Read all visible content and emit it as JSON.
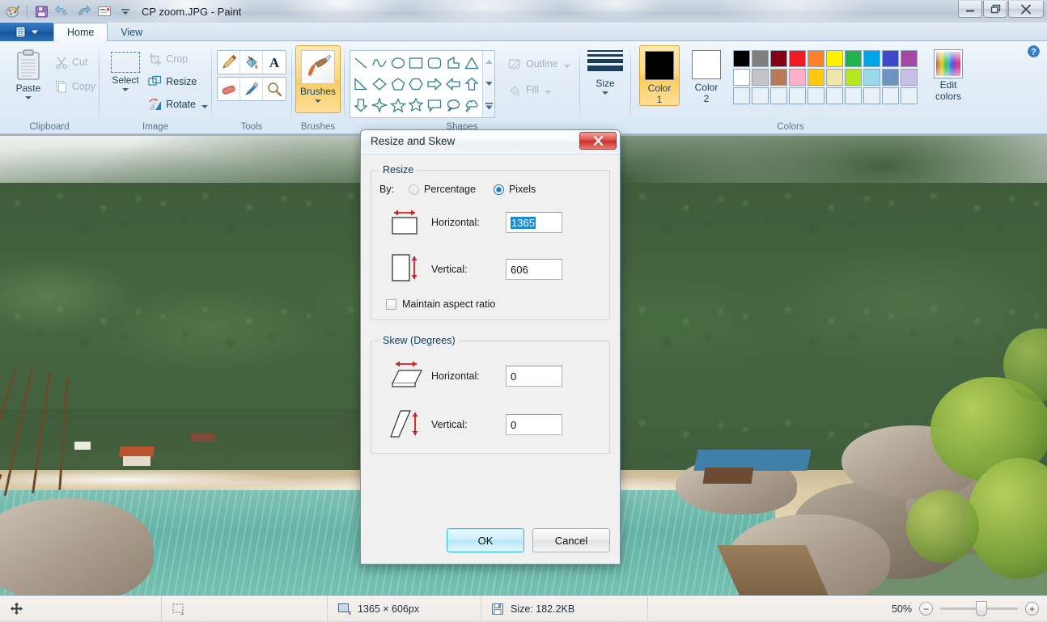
{
  "window": {
    "title": "CP zoom.JPG - Paint",
    "quick_access": [
      {
        "name": "paint-app-icon",
        "label": "Paint"
      },
      {
        "name": "save-icon",
        "label": "Save"
      },
      {
        "name": "undo-icon",
        "label": "Undo"
      },
      {
        "name": "redo-icon",
        "label": "Redo"
      },
      {
        "name": "print-preview-icon",
        "label": "Print preview"
      },
      {
        "name": "customize-qat-icon",
        "label": "Customize Quick Access Toolbar"
      }
    ],
    "controls": [
      {
        "name": "minimize-button",
        "label": "Minimize"
      },
      {
        "name": "restore-button",
        "label": "Restore Down"
      },
      {
        "name": "close-button",
        "label": "Close"
      }
    ]
  },
  "ribbon": {
    "app_menu_label": "File",
    "tabs": [
      {
        "label": "Home",
        "active": true
      },
      {
        "label": "View",
        "active": false
      }
    ],
    "help_label": "Help",
    "groups": [
      {
        "title": "Clipboard",
        "items": [
          {
            "label": "Paste",
            "type": "big",
            "enabled": true
          },
          {
            "label": "Cut",
            "type": "small",
            "enabled": false
          },
          {
            "label": "Copy",
            "type": "small",
            "enabled": false
          }
        ]
      },
      {
        "title": "Image",
        "items": [
          {
            "label": "Select",
            "type": "big",
            "enabled": true
          },
          {
            "label": "Crop",
            "type": "small",
            "enabled": false
          },
          {
            "label": "Resize",
            "type": "small",
            "enabled": true
          },
          {
            "label": "Rotate",
            "type": "small",
            "enabled": true
          }
        ]
      },
      {
        "title": "Tools",
        "tools": [
          "pencil-icon",
          "fill-with-color-icon",
          "text-icon",
          "eraser-icon",
          "color-picker-icon",
          "magnifier-icon"
        ]
      },
      {
        "title": "Brushes",
        "label": "Brushes",
        "selected": true
      },
      {
        "title": "Shapes",
        "shapes": [
          "line",
          "curve",
          "oval",
          "rectangle",
          "rounded-rectangle",
          "polygon",
          "triangle",
          "right-triangle",
          "diamond",
          "pentagon",
          "hexagon",
          "right-arrow",
          "left-arrow",
          "up-arrow",
          "down-arrow",
          "four-point-star",
          "five-point-star",
          "six-point-star",
          "rounded-callout",
          "oval-callout",
          "cloud-callout"
        ],
        "outline_label": "Outline",
        "fill_label": "Fill"
      },
      {
        "title": "Size",
        "label": "Size"
      },
      {
        "title": "Colors",
        "color1_label": "Color\n1",
        "color1_line1": "Color",
        "color1_line2": "1",
        "color2_line1": "Color",
        "color2_line2": "2",
        "color1_value": "#000000",
        "color2_value": "#ffffff",
        "edit_colors_line1": "Edit",
        "edit_colors_line2": "colors",
        "palette_row1": [
          "#000000",
          "#7f7f7f",
          "#880015",
          "#ed1c24",
          "#ff7f27",
          "#fff200",
          "#22b14c",
          "#00a2e8",
          "#3f48cc",
          "#a349a4"
        ],
        "palette_row2": [
          "#ffffff",
          "#c3c3c3",
          "#b97a57",
          "#ffaec9",
          "#ffc90e",
          "#efe4b0",
          "#b5e61d",
          "#99d9ea",
          "#7092be",
          "#c8bfe7"
        ],
        "palette_row3": [
          "",
          "",
          "",
          "",
          "",
          "",
          "",
          "",
          "",
          ""
        ]
      }
    ]
  },
  "dialog": {
    "title": "Resize and Skew",
    "close_label": "Close",
    "resize": {
      "legend": "Resize",
      "by_label": "By:",
      "options": [
        {
          "label": "Percentage",
          "selected": false
        },
        {
          "label": "Pixels",
          "selected": true
        }
      ],
      "horizontal_label": "Horizontal:",
      "horizontal_value": "1365",
      "horizontal_selected": true,
      "vertical_label": "Vertical:",
      "vertical_value": "606",
      "maintain_label": "Maintain aspect ratio",
      "maintain_checked": false
    },
    "skew": {
      "legend": "Skew (Degrees)",
      "horizontal_label": "Horizontal:",
      "horizontal_value": "0",
      "vertical_label": "Vertical:",
      "vertical_value": "0"
    },
    "buttons": {
      "ok": "OK",
      "cancel": "Cancel"
    }
  },
  "statusbar": {
    "cursor_icon": "move-cursor-icon",
    "selection_icon": "selection-size-icon",
    "image_size_icon": "image-size-icon",
    "image_size": "1365 × 606px",
    "file_size_icon": "save-disk-icon",
    "file_size": "Size: 182.2KB",
    "zoom_level": "50%",
    "zoom_out_label": "−",
    "zoom_in_label": "+"
  }
}
